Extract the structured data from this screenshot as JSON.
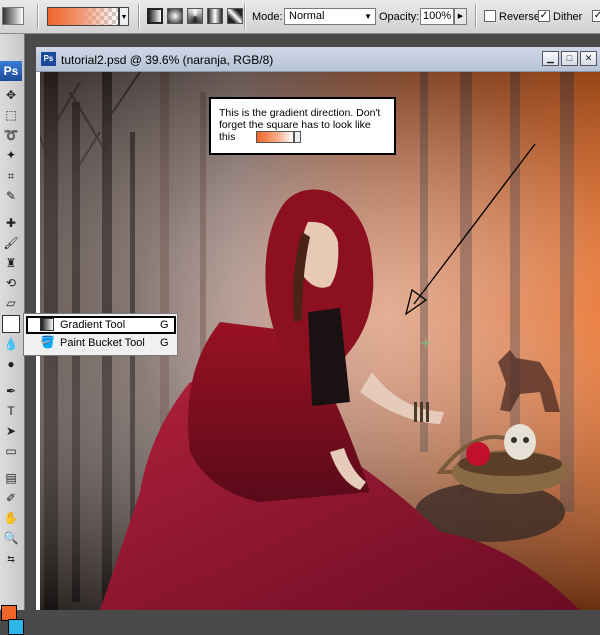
{
  "options_bar": {
    "mode_label": "Mode:",
    "mode_value": "Normal",
    "opacity_label": "Opacity:",
    "opacity_value": "100%",
    "reverse_label": "Reverse",
    "reverse_checked": false,
    "dither_label": "Dither",
    "dither_checked": true,
    "gradient_start_color": "#f06428"
  },
  "toolbox": {
    "logo": "Ps",
    "foreground_color": "#f06428",
    "background_color": "#2fb6e8"
  },
  "document": {
    "icon_text": "Ps",
    "title": "tutorial2.psd @ 39.6% (naranja, RGB/8)"
  },
  "annotation": {
    "text": "This is the gradient direction. Don't forget the square has to look like this"
  },
  "tool_flyout": {
    "items": [
      {
        "label": "Gradient Tool",
        "shortcut": "G",
        "icon": "gradient-tool-icon",
        "selected": true
      },
      {
        "label": "Paint Bucket Tool",
        "shortcut": "G",
        "icon": "paint-bucket-icon",
        "selected": false
      }
    ]
  }
}
